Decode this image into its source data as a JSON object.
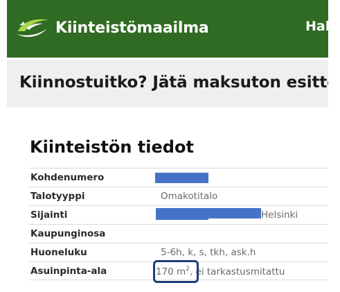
{
  "header": {
    "brand": "Kiinteistömaailma",
    "nav_partial": "Hak",
    "colors": {
      "background": "#2f6b22",
      "logo_accent": "#a6d84a"
    },
    "logo_icon": "swoosh-logo-icon"
  },
  "banner": {
    "text": "Kiinnostuitko? Jätä maksuton esittelypy"
  },
  "property": {
    "title": "Kiinteistön tiedot",
    "rows": [
      {
        "label": "Kohdenumero",
        "value": ""
      },
      {
        "label": "Talotyyppi",
        "value": "Omakotitalo"
      },
      {
        "label": "Sijainti",
        "value": "Helsinki"
      },
      {
        "label": "Kaupunginosa",
        "value": ""
      },
      {
        "label": "Huoneluku",
        "value": "5-6h, k, s, tkh, ask.h"
      },
      {
        "label": "Asuinpinta-ala",
        "area_number": "170 m",
        "area_sup": "2",
        "area_rest": ", ei tarkastusmitattu"
      }
    ],
    "redaction_color": "#4673c8",
    "highlight_color": "#1d3e78"
  }
}
